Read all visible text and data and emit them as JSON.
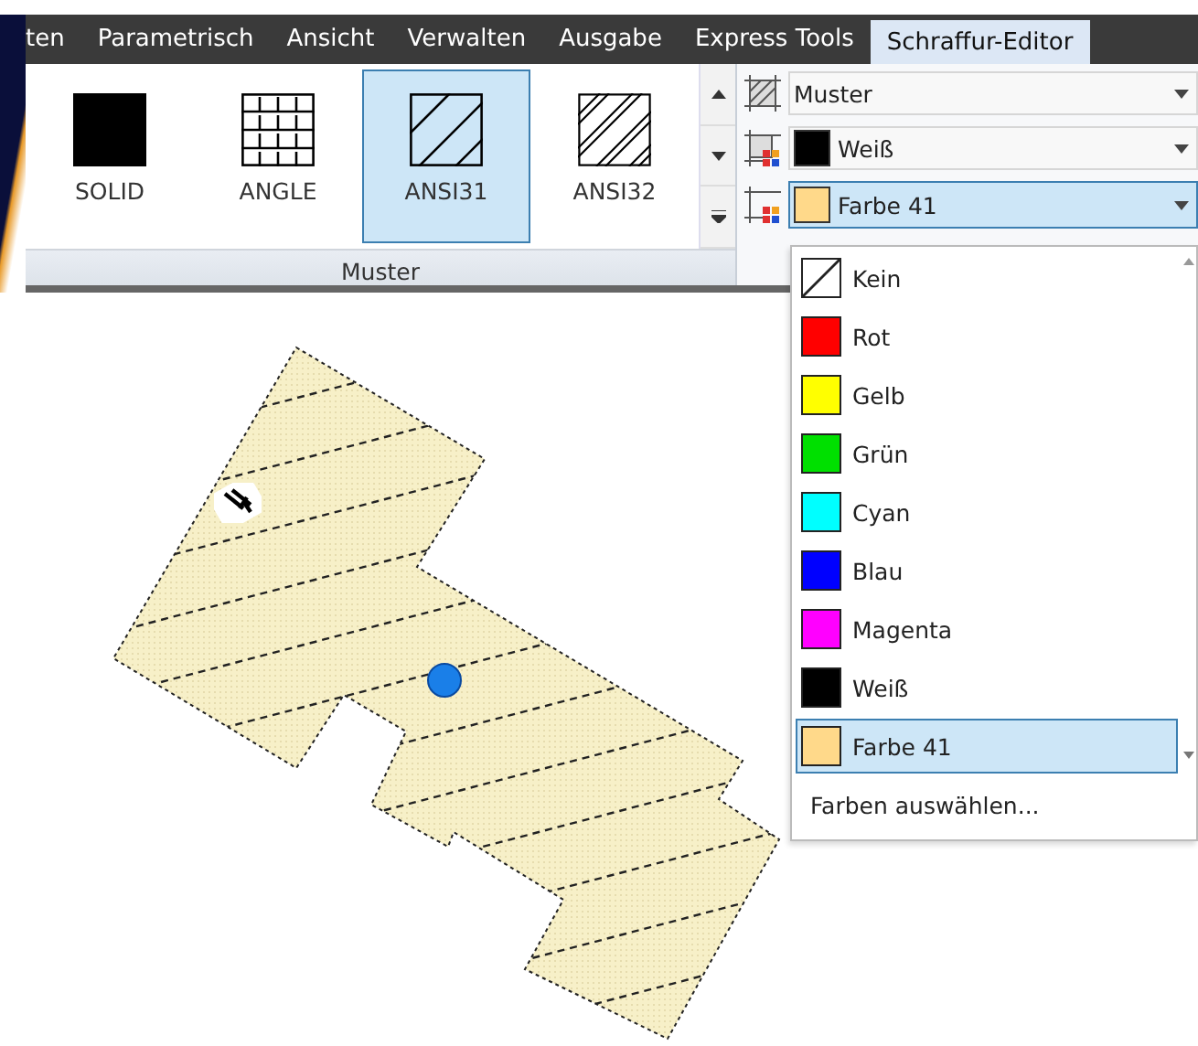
{
  "tabs": [
    {
      "label": "ten",
      "selected": false
    },
    {
      "label": "Parametrisch",
      "selected": false
    },
    {
      "label": "Ansicht",
      "selected": false
    },
    {
      "label": "Verwalten",
      "selected": false
    },
    {
      "label": "Ausgabe",
      "selected": false
    },
    {
      "label": "Express Tools",
      "selected": false
    },
    {
      "label": "Schraffur-Editor",
      "selected": true
    }
  ],
  "pattern_gallery": {
    "panel_label": "Muster",
    "items": [
      {
        "label": "SOLID",
        "kind": "solid",
        "selected": false
      },
      {
        "label": "ANGLE",
        "kind": "angle",
        "selected": false
      },
      {
        "label": "ANSI31",
        "kind": "ansi31",
        "selected": true
      },
      {
        "label": "ANSI32",
        "kind": "ansi32",
        "selected": false
      }
    ]
  },
  "properties": [
    {
      "kind": "pattern",
      "value": "Muster",
      "open": false
    },
    {
      "kind": "background",
      "value": "Weiß",
      "color": "#000000",
      "open": false
    },
    {
      "kind": "foreground",
      "value": "Farbe 41",
      "color": "#ffd98a",
      "open": true
    }
  ],
  "color_list": {
    "items": [
      {
        "label": "Kein",
        "kind": "none",
        "selected": false
      },
      {
        "label": "Rot",
        "color": "#ff0000",
        "selected": false
      },
      {
        "label": "Gelb",
        "color": "#ffff00",
        "selected": false
      },
      {
        "label": "Grün",
        "color": "#00e000",
        "selected": false
      },
      {
        "label": "Cyan",
        "color": "#00ffff",
        "selected": false
      },
      {
        "label": "Blau",
        "color": "#0000ff",
        "selected": false
      },
      {
        "label": "Magenta",
        "color": "#ff00ff",
        "selected": false
      },
      {
        "label": "Weiß",
        "color": "#000000",
        "selected": false
      },
      {
        "label": "Farbe 41",
        "color": "#ffd98a",
        "selected": true
      }
    ],
    "footer": "Farben auswählen..."
  }
}
